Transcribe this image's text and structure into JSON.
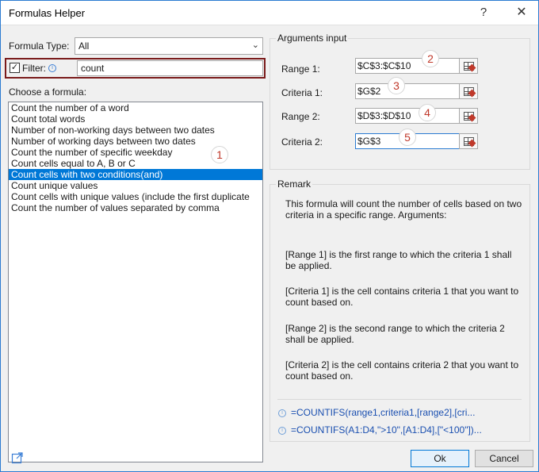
{
  "window": {
    "title": "Formulas Helper",
    "help_glyph": "?",
    "close_glyph": "✕"
  },
  "formula_type": {
    "label": "Formula Type:",
    "value": "All"
  },
  "filter": {
    "label": "Filter:",
    "checked": true,
    "value": "count"
  },
  "choose_label": "Choose a formula:",
  "formulas": [
    "Count the number of a word",
    "Count total words",
    "Number of non-working days between two dates",
    "Number of working days between two dates",
    "Count the number of specific weekday",
    "Count cells equal to A, B or C",
    "Count cells with two conditions(and)",
    "Count unique values",
    "Count cells with unique values (include the first duplicate",
    "Count the number of values separated by comma"
  ],
  "selected_index": 6,
  "markers": [
    "1",
    "2",
    "3",
    "4",
    "5"
  ],
  "arguments": {
    "title": "Arguments input",
    "rows": [
      {
        "label": "Range 1:",
        "value": "$C$3:$C$10"
      },
      {
        "label": "Criteria 1:",
        "value": "$G$2"
      },
      {
        "label": "Range 2:",
        "value": "$D$3:$D$10"
      },
      {
        "label": "Criteria 2:",
        "value": "$G$3"
      }
    ]
  },
  "remark": {
    "title": "Remark",
    "intro": "This formula will count the number of cells based on two criteria in a specific range. Arguments:",
    "paragraphs": [
      "[Range 1] is the first range to which the criteria 1 shall be applied.",
      "[Criteria 1] is the cell contains criteria 1 that you want to count based on.",
      "[Range 2] is the second range to which the criteria 2 shall be applied.",
      "[Criteria 2] is the cell contains criteria 2 that you want to count based on."
    ],
    "formulas": [
      "=COUNTIFS(range1,criteria1,[range2],[cri...",
      "=COUNTIFS(A1:D4,\">10\",[A1:D4],[\"<100\"])..."
    ]
  },
  "buttons": {
    "ok": "Ok",
    "cancel": "Cancel"
  },
  "colors": {
    "accent": "#0078d7",
    "marker": "#c0392b",
    "filter_border": "#7a1b1b",
    "formula_text": "#1a4fb0"
  }
}
